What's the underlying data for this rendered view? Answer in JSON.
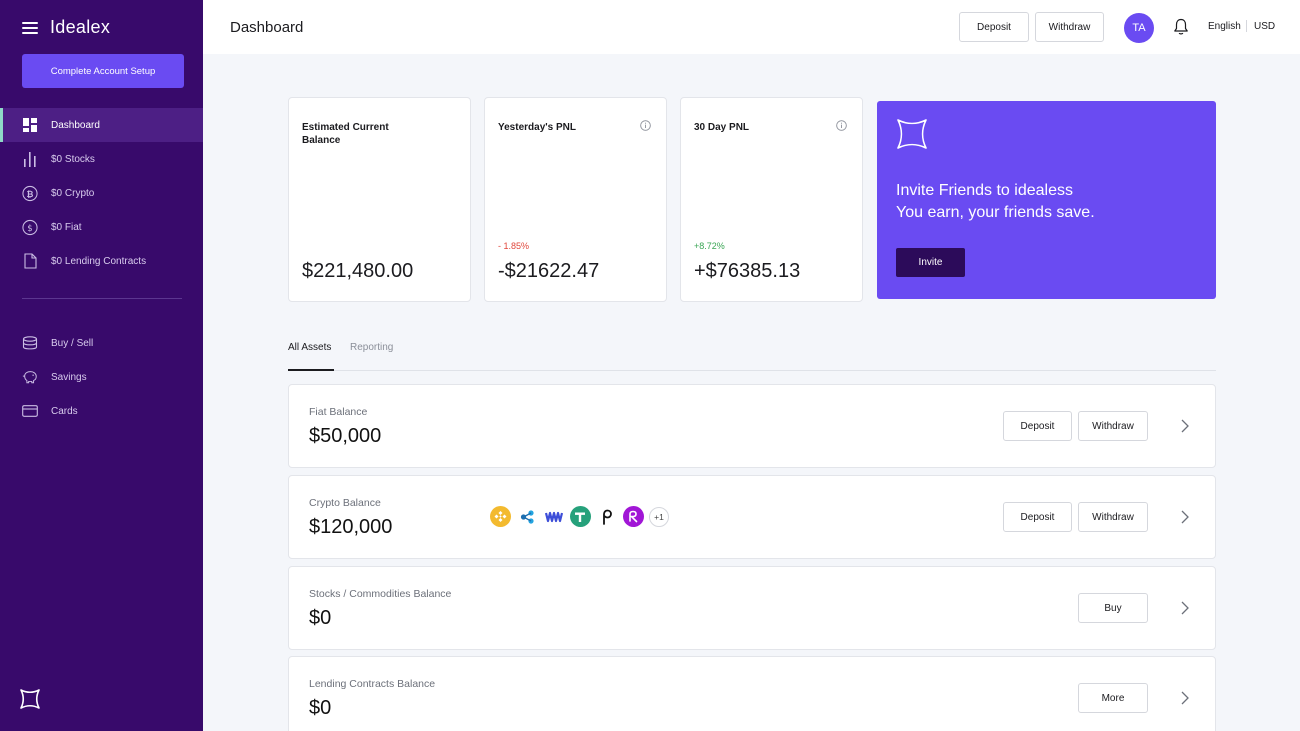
{
  "app": {
    "name": "Idealex"
  },
  "sidebar": {
    "setup_button": "Complete Account Setup",
    "items": [
      {
        "label": "Dashboard",
        "icon": "dashboard-icon",
        "active": true
      },
      {
        "label": "$0 Stocks",
        "icon": "bar-chart-icon"
      },
      {
        "label": "$0 Crypto",
        "icon": "bitcoin-icon"
      },
      {
        "label": "$0 Fiat",
        "icon": "dollar-icon"
      },
      {
        "label": "$0  Lending Contracts",
        "icon": "document-icon"
      }
    ],
    "secondary_items": [
      {
        "label": "Buy / Sell",
        "icon": "coins-stack-icon"
      },
      {
        "label": "Savings",
        "icon": "piggy-bank-icon"
      },
      {
        "label": "Cards",
        "icon": "card-icon"
      }
    ]
  },
  "header": {
    "title": "Dashboard",
    "deposit_label": "Deposit",
    "withdraw_label": "Withdraw",
    "avatar_initials": "TA",
    "language": "English",
    "currency": "USD"
  },
  "stats": [
    {
      "title": "Estimated Current Balance",
      "value": "$221,480.00",
      "change": "",
      "has_info": false
    },
    {
      "title": "Yesterday's PNL",
      "value": "-$21622.47",
      "change": "- 1.85%",
      "trend": "negative",
      "has_info": true
    },
    {
      "title": "30 Day PNL",
      "value": "+$76385.13",
      "change": "+8.72%",
      "trend": "positive",
      "has_info": true
    }
  ],
  "invite": {
    "line1": "Invite Friends to idealess",
    "line2": "You earn, your friends save.",
    "button": "Invite"
  },
  "tabs": [
    {
      "label": "All Assets",
      "active": true
    },
    {
      "label": "Reporting",
      "active": false
    }
  ],
  "balances": [
    {
      "label": "Fiat Balance",
      "value": "$50,000",
      "buttons": [
        "Deposit",
        "Withdraw"
      ]
    },
    {
      "label": "Crypto Balance",
      "value": "$120,000",
      "buttons": [
        "Deposit",
        "Withdraw"
      ],
      "coins": [
        "binance-coin-icon",
        "ripple-icon",
        "waves-icon",
        "tether-icon",
        "polkadot-icon",
        "radix-icon"
      ],
      "more_coins": "+1"
    },
    {
      "label": "Stocks / Commodities Balance",
      "value": "$0",
      "buttons": [
        "Buy"
      ]
    },
    {
      "label": "Lending Contracts Balance",
      "value": "$0",
      "buttons": [
        "More"
      ]
    }
  ],
  "colors": {
    "sidebar": "#380a6b",
    "accent": "#6a4bf2",
    "active_indicator": "#8fd9c7",
    "negative": "#e0453a",
    "positive": "#3aa655"
  }
}
